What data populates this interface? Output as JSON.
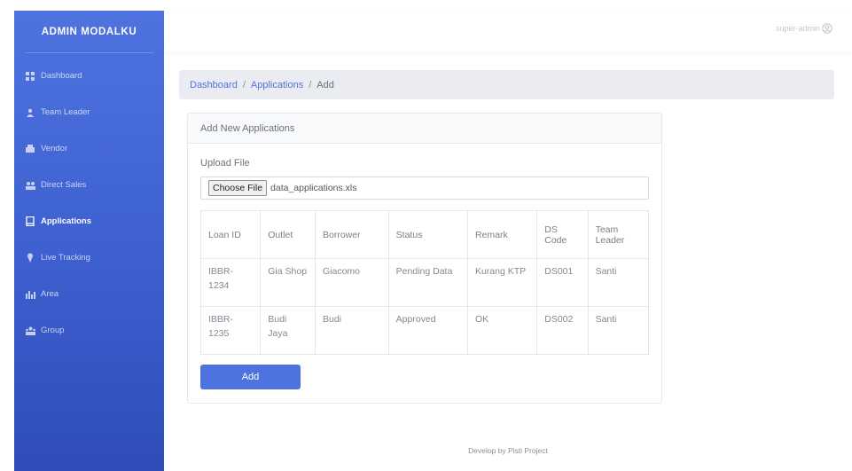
{
  "brand": "ADMIN MODALKU",
  "user": {
    "name": "super-admin",
    "icon": "user-circle-icon"
  },
  "sidebar": {
    "items": [
      {
        "label": "Dashboard",
        "icon": "dashboard-icon"
      },
      {
        "label": "Team Leader",
        "icon": "user-icon"
      },
      {
        "label": "Vendor",
        "icon": "vendor-icon"
      },
      {
        "label": "Direct Sales",
        "icon": "users-icon"
      },
      {
        "label": "Applications",
        "icon": "file-icon",
        "active": true
      },
      {
        "label": "Live Tracking",
        "icon": "map-pin-icon"
      },
      {
        "label": "Area",
        "icon": "area-chart-icon"
      },
      {
        "label": "Group",
        "icon": "group-icon"
      }
    ]
  },
  "breadcrumb": {
    "dashboard": "Dashboard",
    "applications": "Applications",
    "current": "Add",
    "separator": "/"
  },
  "card": {
    "title": "Add New Applications",
    "upload_label": "Upload File",
    "choose_file_label": "Choose File",
    "file_name": "data_applications.xls",
    "add_label": "Add"
  },
  "table": {
    "headers": [
      "Loan ID",
      "Outlet",
      "Borrower",
      "Status",
      "Remark",
      "DS Code",
      "Team Leader"
    ],
    "rows": [
      [
        "IBBR-1234",
        "Gia Shop",
        "Giacomo",
        "Pending Data",
        "Kurang KTP",
        "DS001",
        "Santi"
      ],
      [
        "IBBR-1235",
        "Budi Jaya",
        "Budi",
        "Approved",
        "OK",
        "DS002",
        "Santi"
      ]
    ]
  },
  "footer": "Develop by Pisti Project",
  "colors": {
    "primary": "#4e73df",
    "breadcrumb_bg": "#eaecf1"
  }
}
